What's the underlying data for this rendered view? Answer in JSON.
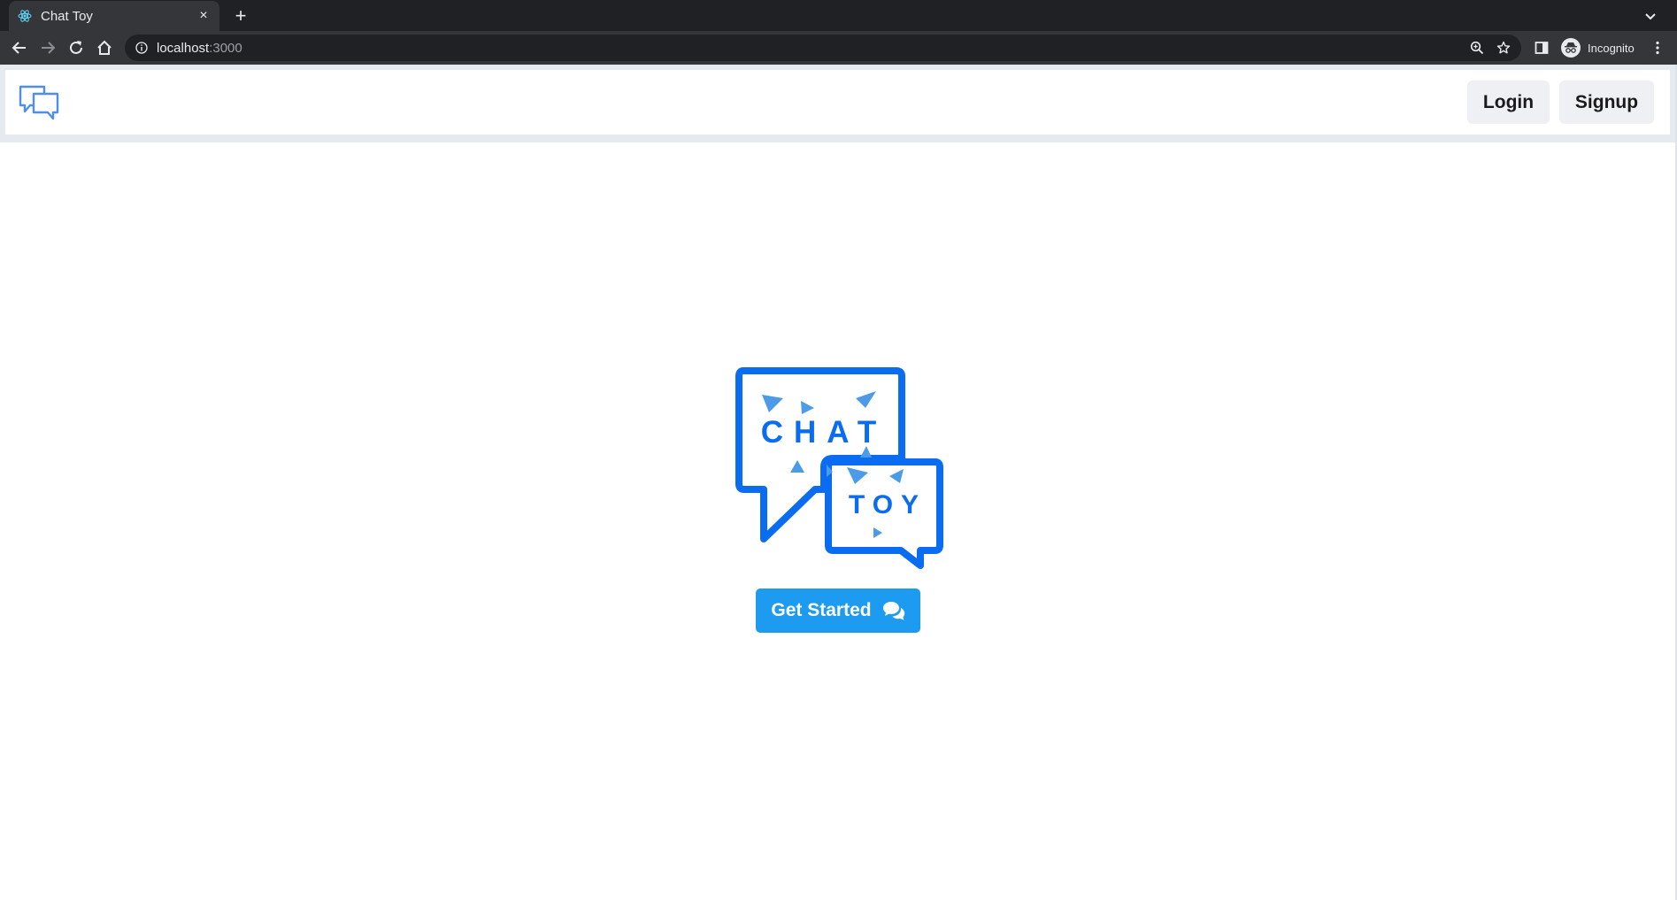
{
  "browser": {
    "tab_title": "Chat Toy",
    "tab_close": "×",
    "new_tab": "+",
    "url_host": "localhost",
    "url_port": ":3000",
    "profile_label": "Incognito"
  },
  "navbar": {
    "login_label": "Login",
    "signup_label": "Signup"
  },
  "hero": {
    "logo_line1": "CHAT",
    "logo_line2": "TOY",
    "cta_label": "Get Started"
  },
  "colors": {
    "brand_blue": "#0a6cf0",
    "logo_triangle": "#4b9be8",
    "cta_blue": "#1d9bf0",
    "nav_button_bg": "#eef0f3"
  },
  "icons": {
    "favicon": "react-atom-icon",
    "brand": "chat-bubbles-outline-icon",
    "cta": "comments-icon"
  }
}
